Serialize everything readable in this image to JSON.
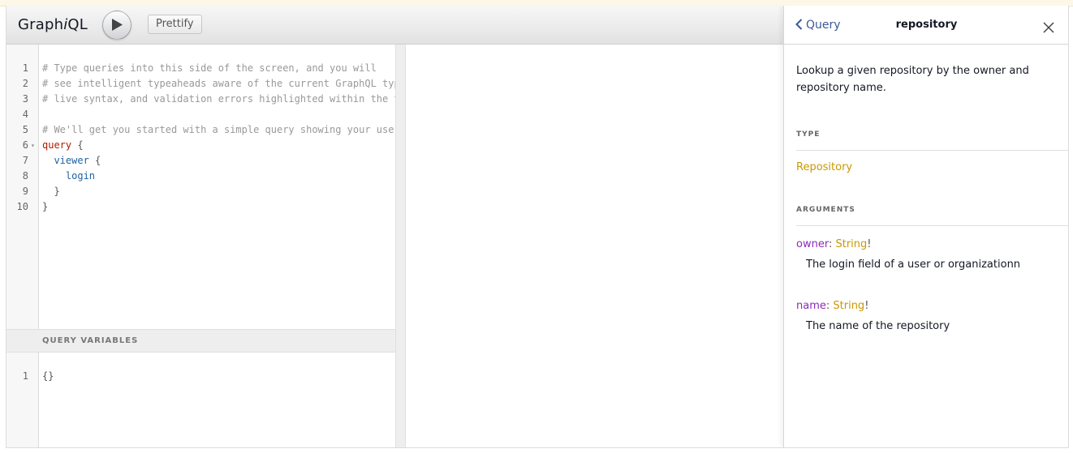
{
  "app": {
    "title_prefix": "Graph",
    "title_italic": "i",
    "title_suffix": "QL",
    "prettify_label": "Prettify"
  },
  "query_editor": {
    "lines": [
      {
        "n": "1",
        "text": "# Type queries into this side of the screen, and you will",
        "kind": "comment"
      },
      {
        "n": "2",
        "text": "# see intelligent typeaheads aware of the current GraphQL typ",
        "kind": "comment"
      },
      {
        "n": "3",
        "text": "# live syntax, and validation errors highlighted within the t",
        "kind": "comment"
      },
      {
        "n": "4",
        "text": "",
        "kind": "blank"
      },
      {
        "n": "5",
        "text": "# We'll get you started with a simple query showing your user",
        "kind": "comment"
      },
      {
        "n": "6",
        "keyword": "query",
        "punct": " {",
        "kind": "keyword"
      },
      {
        "n": "7",
        "field": "  viewer",
        "punct": " {",
        "kind": "field"
      },
      {
        "n": "8",
        "field": "    login",
        "punct": "",
        "kind": "field"
      },
      {
        "n": "9",
        "punct": "  }",
        "kind": "punct"
      },
      {
        "n": "10",
        "punct": "}",
        "kind": "punct"
      }
    ]
  },
  "variables": {
    "header": "QUERY VARIABLES",
    "lines": [
      {
        "n": "1",
        "text": "{}"
      }
    ]
  },
  "docs": {
    "back_label": "Query",
    "title": "repository",
    "description": "Lookup a given repository by the owner and repository name.",
    "type_section": "TYPE",
    "type_name": "Repository",
    "arguments_section": "ARGUMENTS",
    "arguments": [
      {
        "name": "owner",
        "colon": ": ",
        "type": "String",
        "bang": "!",
        "description": "The login field of a user or organizationn"
      },
      {
        "name": "name",
        "colon": ": ",
        "type": "String",
        "bang": "!",
        "description": "The name of the repository"
      }
    ]
  },
  "colors": {
    "comment": "#999999",
    "keyword": "#B11A04",
    "field": "#1F61A0",
    "type": "#CA9800",
    "argument": "#8B2BB9",
    "link": "#3B5998"
  }
}
